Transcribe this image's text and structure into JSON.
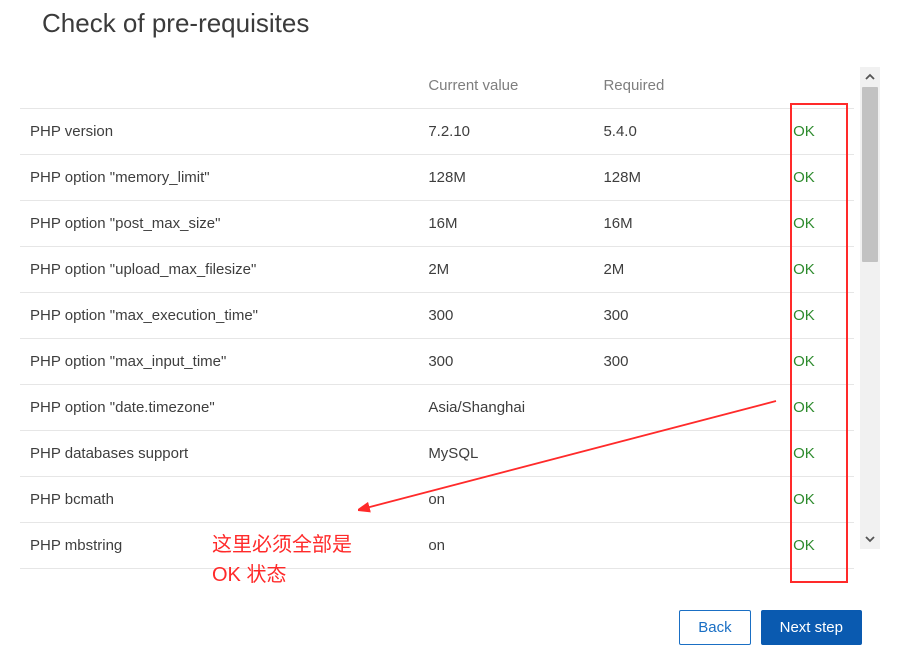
{
  "title": "Check of pre-requisites",
  "columns": {
    "current": "Current value",
    "required": "Required"
  },
  "rows": [
    {
      "name": "PHP version",
      "current": "7.2.10",
      "required": "5.4.0",
      "status": "OK"
    },
    {
      "name": "PHP option \"memory_limit\"",
      "current": "128M",
      "required": "128M",
      "status": "OK"
    },
    {
      "name": "PHP option \"post_max_size\"",
      "current": "16M",
      "required": "16M",
      "status": "OK"
    },
    {
      "name": "PHP option \"upload_max_filesize\"",
      "current": "2M",
      "required": "2M",
      "status": "OK"
    },
    {
      "name": "PHP option \"max_execution_time\"",
      "current": "300",
      "required": "300",
      "status": "OK"
    },
    {
      "name": "PHP option \"max_input_time\"",
      "current": "300",
      "required": "300",
      "status": "OK"
    },
    {
      "name": "PHP option \"date.timezone\"",
      "current": "Asia/Shanghai",
      "required": "",
      "status": "OK"
    },
    {
      "name": "PHP databases support",
      "current": "MySQL",
      "required": "",
      "status": "OK"
    },
    {
      "name": "PHP bcmath",
      "current": "on",
      "required": "",
      "status": "OK"
    },
    {
      "name": "PHP mbstring",
      "current": "on",
      "required": "",
      "status": "OK"
    }
  ],
  "annotation": {
    "line1": "这里必须全部是",
    "line2": "OK 状态"
  },
  "buttons": {
    "back": "Back",
    "next": "Next step"
  }
}
